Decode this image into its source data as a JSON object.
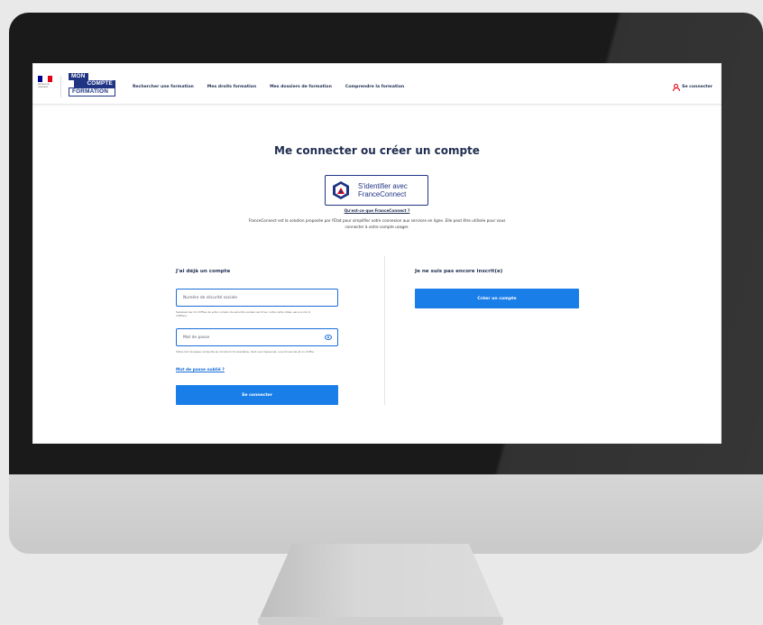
{
  "colors": {
    "brand_blue": "#1f3584",
    "primary_button": "#1a7ee8",
    "field_border": "#1a6ed8",
    "accent_red": "#e1000f",
    "flag_blue": "#000091",
    "flag_white": "#ffffff",
    "flag_red": "#e1000f"
  },
  "header": {
    "republic_label": "RÉPUBLIQUE FRANÇAISE",
    "logo": {
      "line1": "MON",
      "line2": "COMPTE",
      "line3": "FORMATION"
    },
    "nav": [
      {
        "label": "Rechercher une formation"
      },
      {
        "label": "Mes droits formation"
      },
      {
        "label": "Mes dossiers de formation"
      },
      {
        "label": "Comprendre la formation"
      }
    ],
    "login_label": "Se connecter",
    "login_icon": "user-icon"
  },
  "main": {
    "title": "Me connecter ou créer un compte",
    "franceconnect": {
      "button_line1": "S'identifier avec",
      "button_line2": "FranceConnect",
      "question": "Qu'est-ce que FranceConnect ?",
      "description": "FranceConnect est la solution proposée par l'État pour simplifier votre connexion aux services en ligne. Elle peut être utilisée pour vous connecter à votre compte usager."
    },
    "login": {
      "heading": "J'ai déjà un compte",
      "ssn_placeholder": "Numéro de sécurité sociale",
      "ssn_hint": "Saisissez les 13 chiffres de votre numéro de sécurité sociale inscrit sur votre carte vitale, sans la clé (2 chiffres).",
      "password_placeholder": "Mot de passe",
      "password_hint": "Votre mot de passe comporte au minimum 8 caractères, dont une majuscule, une minuscule et un chiffre.",
      "forgot_label": "Mot de passe oublié ?",
      "submit_label": "Se connecter",
      "eye_icon": "eye-icon"
    },
    "register": {
      "heading": "Je ne suis pas encore inscrit(e)",
      "create_label": "Créer un compte"
    }
  }
}
